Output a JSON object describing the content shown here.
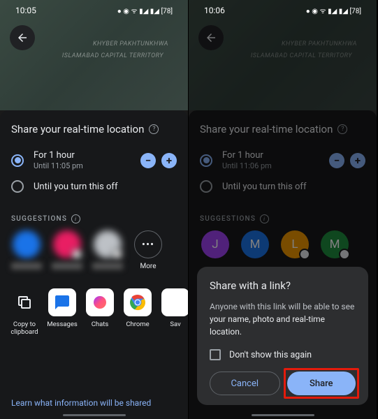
{
  "status": {
    "time_left": "10:05",
    "time_right": "10:06"
  },
  "map": {
    "region1": "KHYBER PAKHTUNKHWA",
    "region2": "ISLAMABAD CAPITAL TERRITORY"
  },
  "sheet": {
    "title": "Share your real-time location",
    "option1": {
      "label": "For 1 hour",
      "until_left": "Until 11:05 pm",
      "until_right": "Until 11:06 pm"
    },
    "option2": {
      "label": "Until you turn this off"
    },
    "suggestions_label": "SUGGESTIONS",
    "more_label": "More"
  },
  "contacts": [
    {
      "letter": "J",
      "color": "#a142f4"
    },
    {
      "letter": "M",
      "color": "#1a73e8"
    },
    {
      "letter": "L",
      "color": "#f29900"
    },
    {
      "letter": "M",
      "color": "#1e8e3e"
    }
  ],
  "apps": {
    "copy": "Copy to clipboard",
    "messages": "Messages",
    "chats": "Chats",
    "chrome": "Chrome",
    "save": "Sav"
  },
  "footer_link": "Learn what information will be shared",
  "dialog": {
    "title": "Share with a link?",
    "body_pre": "Anyone with this link will be able to see ",
    "body_em": "your name, photo and real-time location.",
    "checkbox": "Don't show this again",
    "cancel": "Cancel",
    "share": "Share"
  }
}
